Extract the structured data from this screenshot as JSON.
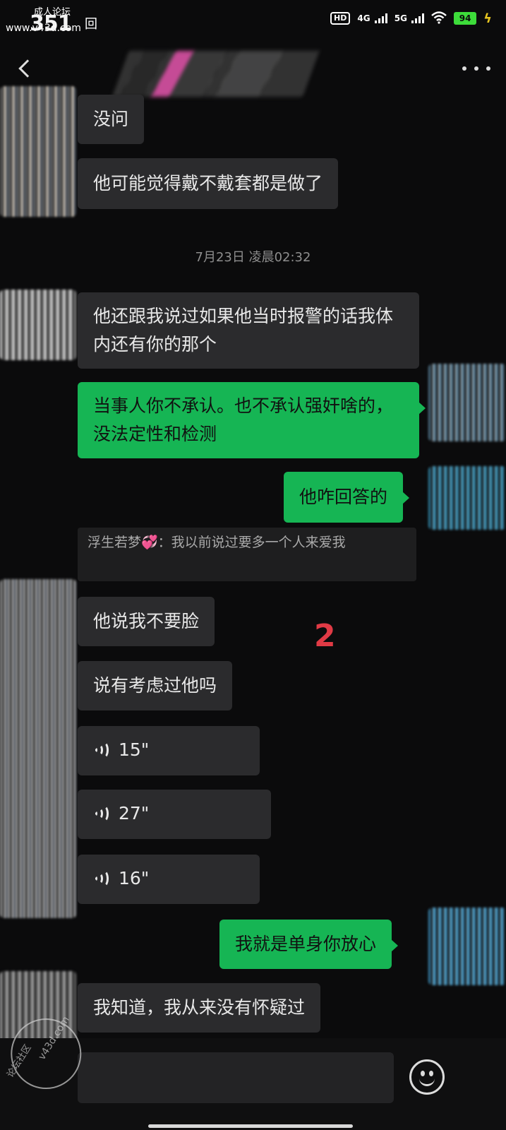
{
  "status_bar": {
    "watermark_line1": "成人论坛",
    "watermark_line2": "351",
    "watermark_url": "www.v43d.com",
    "watermark_extra": "回",
    "hd_label": "HD",
    "net_4g": "4G",
    "net_5g": "5G",
    "battery": "94"
  },
  "header": {
    "back_icon": "chevron-left-icon",
    "title": "",
    "more_icon": "more-icon"
  },
  "messages": [
    {
      "side": "in",
      "text": "没问"
    },
    {
      "side": "in",
      "text": "他可能觉得戴不戴套都是做了"
    },
    {
      "side": "time",
      "text": "7月23日 凌晨02:32"
    },
    {
      "side": "in",
      "text": "他还跟我说过如果他当时报警的话我体内还有你的那个"
    },
    {
      "side": "out",
      "text": "当事人你不承认。也不承认强奸啥的，没法定性和检测"
    },
    {
      "side": "out",
      "text": "他咋回答的"
    },
    {
      "side": "quote",
      "text": "浮生若梦💞：我以前说过要多一个人来爱我"
    },
    {
      "side": "in",
      "text": "他说我不要脸"
    },
    {
      "side": "in",
      "text": "说有考虑过他吗"
    },
    {
      "side": "voice",
      "text": "15\""
    },
    {
      "side": "voice",
      "text": "27\""
    },
    {
      "side": "voice",
      "text": "16\""
    },
    {
      "side": "out",
      "text": "我就是单身你放心"
    },
    {
      "side": "in",
      "text": "我知道，我从来没有怀疑过"
    }
  ],
  "marker": "2",
  "input_bar": {
    "emoji_icon": "emoji-icon",
    "watermark_text1": "论坛社区",
    "watermark_text2": "v43d.com"
  }
}
